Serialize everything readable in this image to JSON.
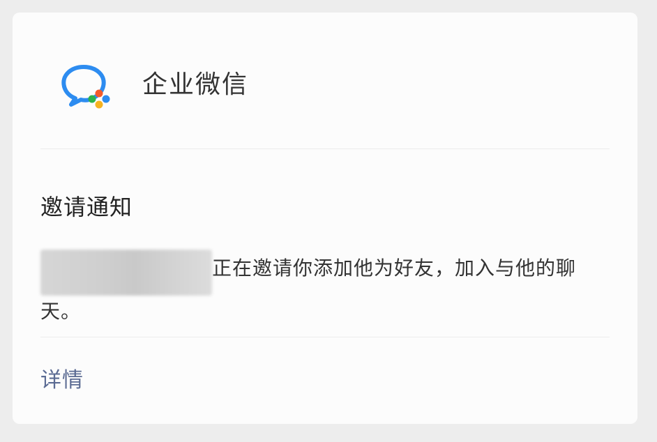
{
  "header": {
    "app_name": "企业微信",
    "logo_icon": "wecom-logo-icon"
  },
  "notice": {
    "title": "邀请通知",
    "sender_redacted": true,
    "body_text": "正在邀请你添加他为好友，加入与他的聊天。"
  },
  "footer": {
    "details_label": "详情"
  },
  "colors": {
    "background": "#ededed",
    "card": "#fcfcfc",
    "link": "#5b6b93",
    "logo_blue": "#2d8cf0",
    "logo_green": "#2bb24c",
    "logo_red": "#f25a2b",
    "logo_yellow": "#f5b321"
  }
}
